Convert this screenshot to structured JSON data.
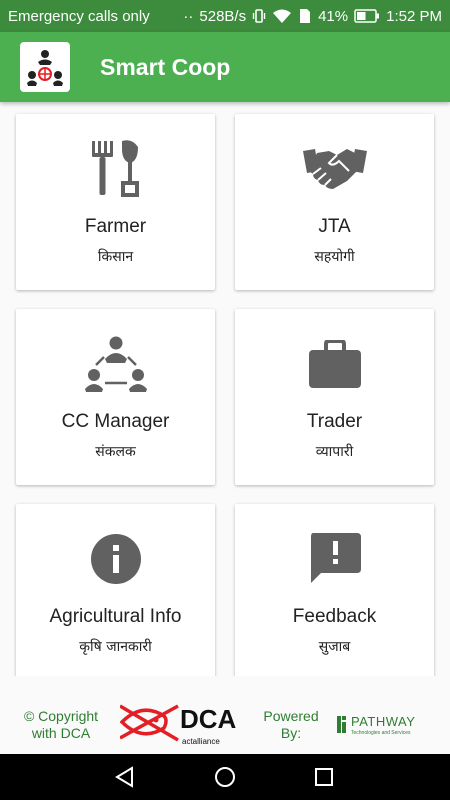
{
  "status": {
    "carrier": "Emergency calls only",
    "speed": "528B/s",
    "battery": "41%",
    "time": "1:52 PM"
  },
  "app": {
    "title": "Smart Coop",
    "logo_icon": "coop-people-logo"
  },
  "cards": [
    {
      "title": "Farmer",
      "subtitle": "किसान",
      "icon": "farm-tools-icon"
    },
    {
      "title": "JTA",
      "subtitle": "सहयोगी",
      "icon": "handshake-icon"
    },
    {
      "title": "CC Manager",
      "subtitle": "संकलक",
      "icon": "group-icon"
    },
    {
      "title": "Trader",
      "subtitle": "व्यापारी",
      "icon": "briefcase-icon"
    },
    {
      "title": "Agricultural Info",
      "subtitle": "कृषि जानकारी",
      "icon": "info-icon"
    },
    {
      "title": "Feedback",
      "subtitle": "सुजाब",
      "icon": "feedback-icon"
    }
  ],
  "footer": {
    "copyright": "© Copyright with DCA",
    "dca_text": "DCA",
    "dca_sub": "actalliance",
    "powered": "Powered By:",
    "pathway_text": "PATHWAY",
    "pathway_sub": "Technologies and Services"
  },
  "colors": {
    "primary": "#4caf50",
    "status_bar": "#3d8b3d",
    "icon_gray": "#616161",
    "footer_text": "#2e7d32",
    "dca_red": "#e31e24"
  }
}
